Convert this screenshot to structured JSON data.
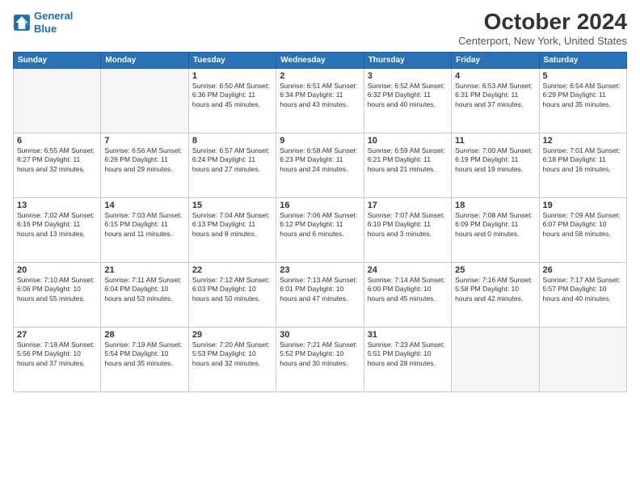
{
  "header": {
    "logo_line1": "General",
    "logo_line2": "Blue",
    "month_title": "October 2024",
    "location": "Centerport, New York, United States"
  },
  "weekdays": [
    "Sunday",
    "Monday",
    "Tuesday",
    "Wednesday",
    "Thursday",
    "Friday",
    "Saturday"
  ],
  "weeks": [
    [
      {
        "day": "",
        "info": ""
      },
      {
        "day": "",
        "info": ""
      },
      {
        "day": "1",
        "info": "Sunrise: 6:50 AM\nSunset: 6:36 PM\nDaylight: 11 hours and 45 minutes."
      },
      {
        "day": "2",
        "info": "Sunrise: 6:51 AM\nSunset: 6:34 PM\nDaylight: 11 hours and 43 minutes."
      },
      {
        "day": "3",
        "info": "Sunrise: 6:52 AM\nSunset: 6:32 PM\nDaylight: 11 hours and 40 minutes."
      },
      {
        "day": "4",
        "info": "Sunrise: 6:53 AM\nSunset: 6:31 PM\nDaylight: 11 hours and 37 minutes."
      },
      {
        "day": "5",
        "info": "Sunrise: 6:54 AM\nSunset: 6:29 PM\nDaylight: 11 hours and 35 minutes."
      }
    ],
    [
      {
        "day": "6",
        "info": "Sunrise: 6:55 AM\nSunset: 6:27 PM\nDaylight: 11 hours and 32 minutes."
      },
      {
        "day": "7",
        "info": "Sunrise: 6:56 AM\nSunset: 6:26 PM\nDaylight: 11 hours and 29 minutes."
      },
      {
        "day": "8",
        "info": "Sunrise: 6:57 AM\nSunset: 6:24 PM\nDaylight: 11 hours and 27 minutes."
      },
      {
        "day": "9",
        "info": "Sunrise: 6:58 AM\nSunset: 6:23 PM\nDaylight: 11 hours and 24 minutes."
      },
      {
        "day": "10",
        "info": "Sunrise: 6:59 AM\nSunset: 6:21 PM\nDaylight: 11 hours and 21 minutes."
      },
      {
        "day": "11",
        "info": "Sunrise: 7:00 AM\nSunset: 6:19 PM\nDaylight: 11 hours and 19 minutes."
      },
      {
        "day": "12",
        "info": "Sunrise: 7:01 AM\nSunset: 6:18 PM\nDaylight: 11 hours and 16 minutes."
      }
    ],
    [
      {
        "day": "13",
        "info": "Sunrise: 7:02 AM\nSunset: 6:16 PM\nDaylight: 11 hours and 13 minutes."
      },
      {
        "day": "14",
        "info": "Sunrise: 7:03 AM\nSunset: 6:15 PM\nDaylight: 11 hours and 11 minutes."
      },
      {
        "day": "15",
        "info": "Sunrise: 7:04 AM\nSunset: 6:13 PM\nDaylight: 11 hours and 8 minutes."
      },
      {
        "day": "16",
        "info": "Sunrise: 7:06 AM\nSunset: 6:12 PM\nDaylight: 11 hours and 6 minutes."
      },
      {
        "day": "17",
        "info": "Sunrise: 7:07 AM\nSunset: 6:10 PM\nDaylight: 11 hours and 3 minutes."
      },
      {
        "day": "18",
        "info": "Sunrise: 7:08 AM\nSunset: 6:09 PM\nDaylight: 11 hours and 0 minutes."
      },
      {
        "day": "19",
        "info": "Sunrise: 7:09 AM\nSunset: 6:07 PM\nDaylight: 10 hours and 58 minutes."
      }
    ],
    [
      {
        "day": "20",
        "info": "Sunrise: 7:10 AM\nSunset: 6:06 PM\nDaylight: 10 hours and 55 minutes."
      },
      {
        "day": "21",
        "info": "Sunrise: 7:11 AM\nSunset: 6:04 PM\nDaylight: 10 hours and 53 minutes."
      },
      {
        "day": "22",
        "info": "Sunrise: 7:12 AM\nSunset: 6:03 PM\nDaylight: 10 hours and 50 minutes."
      },
      {
        "day": "23",
        "info": "Sunrise: 7:13 AM\nSunset: 6:01 PM\nDaylight: 10 hours and 47 minutes."
      },
      {
        "day": "24",
        "info": "Sunrise: 7:14 AM\nSunset: 6:00 PM\nDaylight: 10 hours and 45 minutes."
      },
      {
        "day": "25",
        "info": "Sunrise: 7:16 AM\nSunset: 5:58 PM\nDaylight: 10 hours and 42 minutes."
      },
      {
        "day": "26",
        "info": "Sunrise: 7:17 AM\nSunset: 5:57 PM\nDaylight: 10 hours and 40 minutes."
      }
    ],
    [
      {
        "day": "27",
        "info": "Sunrise: 7:18 AM\nSunset: 5:56 PM\nDaylight: 10 hours and 37 minutes."
      },
      {
        "day": "28",
        "info": "Sunrise: 7:19 AM\nSunset: 5:54 PM\nDaylight: 10 hours and 35 minutes."
      },
      {
        "day": "29",
        "info": "Sunrise: 7:20 AM\nSunset: 5:53 PM\nDaylight: 10 hours and 32 minutes."
      },
      {
        "day": "30",
        "info": "Sunrise: 7:21 AM\nSunset: 5:52 PM\nDaylight: 10 hours and 30 minutes."
      },
      {
        "day": "31",
        "info": "Sunrise: 7:23 AM\nSunset: 5:51 PM\nDaylight: 10 hours and 28 minutes."
      },
      {
        "day": "",
        "info": ""
      },
      {
        "day": "",
        "info": ""
      }
    ]
  ]
}
